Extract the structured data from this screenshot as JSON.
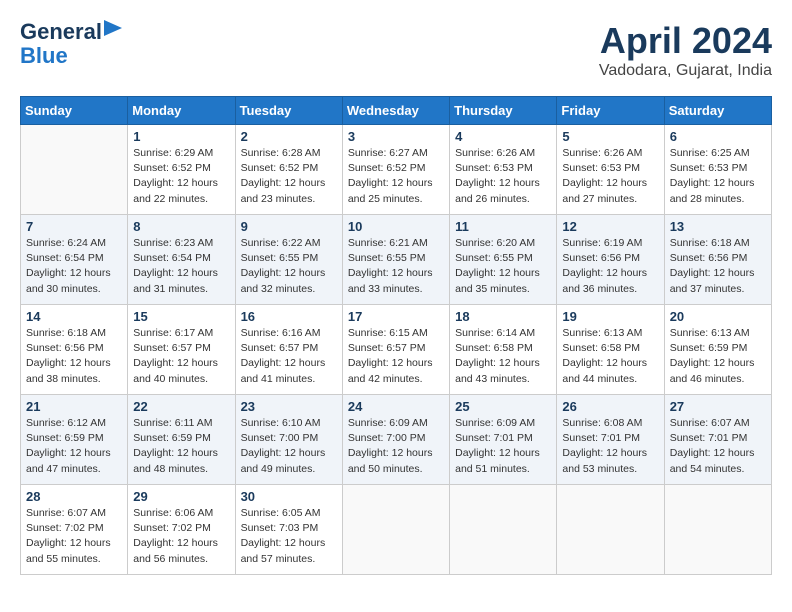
{
  "header": {
    "logo_line1": "General",
    "logo_line2": "Blue",
    "month": "April 2024",
    "location": "Vadodara, Gujarat, India"
  },
  "weekdays": [
    "Sunday",
    "Monday",
    "Tuesday",
    "Wednesday",
    "Thursday",
    "Friday",
    "Saturday"
  ],
  "weeks": [
    [
      {
        "day": "",
        "info": ""
      },
      {
        "day": "1",
        "info": "Sunrise: 6:29 AM\nSunset: 6:52 PM\nDaylight: 12 hours\nand 22 minutes."
      },
      {
        "day": "2",
        "info": "Sunrise: 6:28 AM\nSunset: 6:52 PM\nDaylight: 12 hours\nand 23 minutes."
      },
      {
        "day": "3",
        "info": "Sunrise: 6:27 AM\nSunset: 6:52 PM\nDaylight: 12 hours\nand 25 minutes."
      },
      {
        "day": "4",
        "info": "Sunrise: 6:26 AM\nSunset: 6:53 PM\nDaylight: 12 hours\nand 26 minutes."
      },
      {
        "day": "5",
        "info": "Sunrise: 6:26 AM\nSunset: 6:53 PM\nDaylight: 12 hours\nand 27 minutes."
      },
      {
        "day": "6",
        "info": "Sunrise: 6:25 AM\nSunset: 6:53 PM\nDaylight: 12 hours\nand 28 minutes."
      }
    ],
    [
      {
        "day": "7",
        "info": "Sunrise: 6:24 AM\nSunset: 6:54 PM\nDaylight: 12 hours\nand 30 minutes."
      },
      {
        "day": "8",
        "info": "Sunrise: 6:23 AM\nSunset: 6:54 PM\nDaylight: 12 hours\nand 31 minutes."
      },
      {
        "day": "9",
        "info": "Sunrise: 6:22 AM\nSunset: 6:55 PM\nDaylight: 12 hours\nand 32 minutes."
      },
      {
        "day": "10",
        "info": "Sunrise: 6:21 AM\nSunset: 6:55 PM\nDaylight: 12 hours\nand 33 minutes."
      },
      {
        "day": "11",
        "info": "Sunrise: 6:20 AM\nSunset: 6:55 PM\nDaylight: 12 hours\nand 35 minutes."
      },
      {
        "day": "12",
        "info": "Sunrise: 6:19 AM\nSunset: 6:56 PM\nDaylight: 12 hours\nand 36 minutes."
      },
      {
        "day": "13",
        "info": "Sunrise: 6:18 AM\nSunset: 6:56 PM\nDaylight: 12 hours\nand 37 minutes."
      }
    ],
    [
      {
        "day": "14",
        "info": "Sunrise: 6:18 AM\nSunset: 6:56 PM\nDaylight: 12 hours\nand 38 minutes."
      },
      {
        "day": "15",
        "info": "Sunrise: 6:17 AM\nSunset: 6:57 PM\nDaylight: 12 hours\nand 40 minutes."
      },
      {
        "day": "16",
        "info": "Sunrise: 6:16 AM\nSunset: 6:57 PM\nDaylight: 12 hours\nand 41 minutes."
      },
      {
        "day": "17",
        "info": "Sunrise: 6:15 AM\nSunset: 6:57 PM\nDaylight: 12 hours\nand 42 minutes."
      },
      {
        "day": "18",
        "info": "Sunrise: 6:14 AM\nSunset: 6:58 PM\nDaylight: 12 hours\nand 43 minutes."
      },
      {
        "day": "19",
        "info": "Sunrise: 6:13 AM\nSunset: 6:58 PM\nDaylight: 12 hours\nand 44 minutes."
      },
      {
        "day": "20",
        "info": "Sunrise: 6:13 AM\nSunset: 6:59 PM\nDaylight: 12 hours\nand 46 minutes."
      }
    ],
    [
      {
        "day": "21",
        "info": "Sunrise: 6:12 AM\nSunset: 6:59 PM\nDaylight: 12 hours\nand 47 minutes."
      },
      {
        "day": "22",
        "info": "Sunrise: 6:11 AM\nSunset: 6:59 PM\nDaylight: 12 hours\nand 48 minutes."
      },
      {
        "day": "23",
        "info": "Sunrise: 6:10 AM\nSunset: 7:00 PM\nDaylight: 12 hours\nand 49 minutes."
      },
      {
        "day": "24",
        "info": "Sunrise: 6:09 AM\nSunset: 7:00 PM\nDaylight: 12 hours\nand 50 minutes."
      },
      {
        "day": "25",
        "info": "Sunrise: 6:09 AM\nSunset: 7:01 PM\nDaylight: 12 hours\nand 51 minutes."
      },
      {
        "day": "26",
        "info": "Sunrise: 6:08 AM\nSunset: 7:01 PM\nDaylight: 12 hours\nand 53 minutes."
      },
      {
        "day": "27",
        "info": "Sunrise: 6:07 AM\nSunset: 7:01 PM\nDaylight: 12 hours\nand 54 minutes."
      }
    ],
    [
      {
        "day": "28",
        "info": "Sunrise: 6:07 AM\nSunset: 7:02 PM\nDaylight: 12 hours\nand 55 minutes."
      },
      {
        "day": "29",
        "info": "Sunrise: 6:06 AM\nSunset: 7:02 PM\nDaylight: 12 hours\nand 56 minutes."
      },
      {
        "day": "30",
        "info": "Sunrise: 6:05 AM\nSunset: 7:03 PM\nDaylight: 12 hours\nand 57 minutes."
      },
      {
        "day": "",
        "info": ""
      },
      {
        "day": "",
        "info": ""
      },
      {
        "day": "",
        "info": ""
      },
      {
        "day": "",
        "info": ""
      }
    ]
  ]
}
